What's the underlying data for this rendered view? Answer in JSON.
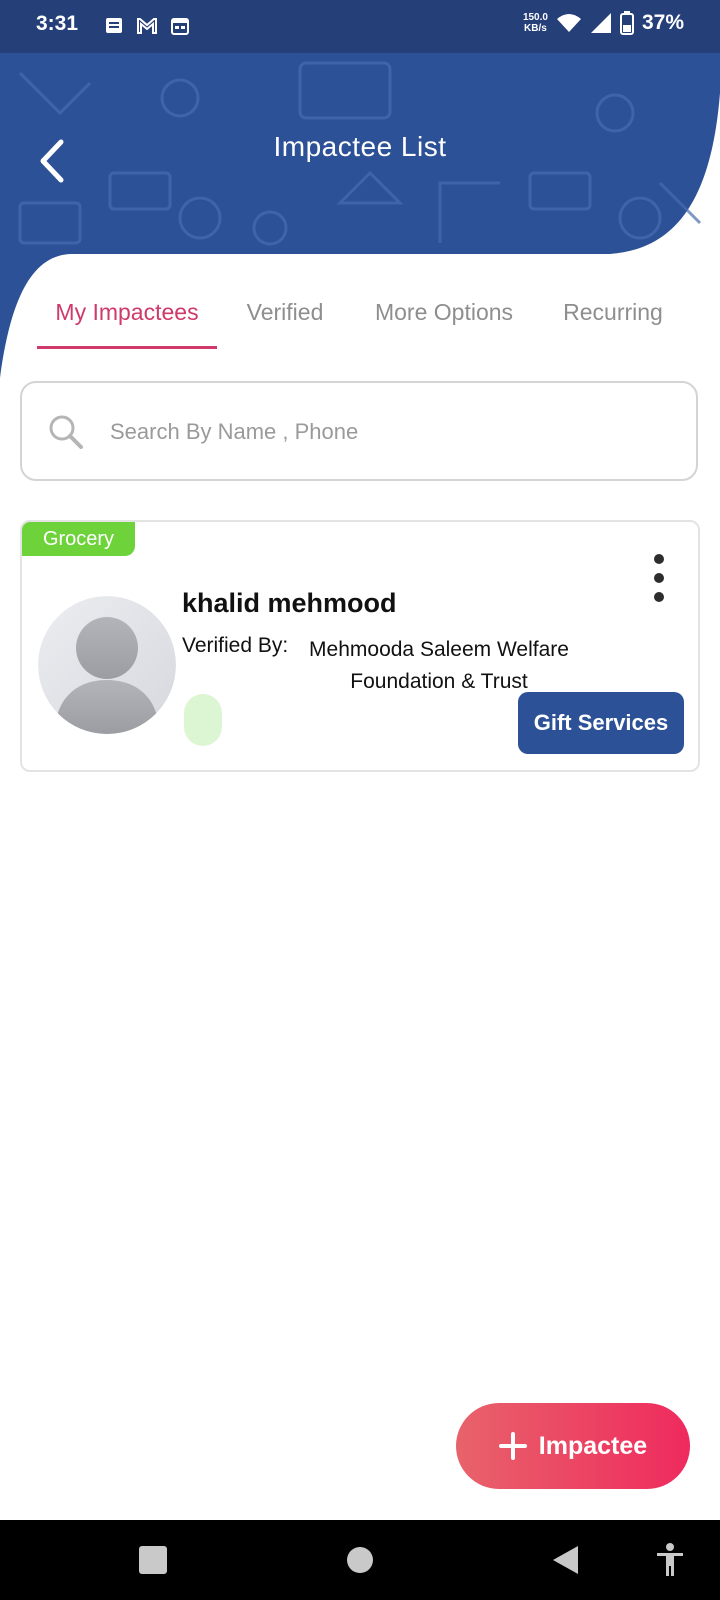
{
  "status_bar": {
    "time": "3:31",
    "net_speed_value": "150.0",
    "net_speed_unit": "KB/s",
    "battery": "37%",
    "icons_left": [
      "message-icon",
      "gmail-icon",
      "calendar-icon"
    ],
    "icons_right": [
      "wifi-icon",
      "signal-icon",
      "battery-icon"
    ]
  },
  "header": {
    "title": "Impactee List",
    "color": "#2c5197"
  },
  "tabs": [
    {
      "label": "My Impactees",
      "active": true
    },
    {
      "label": "Verified",
      "active": false
    },
    {
      "label": "More Options",
      "active": false
    },
    {
      "label": "Recurring",
      "active": false
    }
  ],
  "search": {
    "placeholder": "Search By Name , Phone",
    "value": ""
  },
  "impactees": [
    {
      "category": "Grocery",
      "name": "khalid mehmood",
      "verified_by_label": "Verified By:",
      "verified_by": "Mehmooda Saleem Welfare Foundation & Trust",
      "action_label": "Gift Services"
    }
  ],
  "fab": {
    "label": "Impactee",
    "icon": "plus-icon"
  },
  "colors": {
    "accent": "#cf3a6a",
    "primary": "#2c5197",
    "badge_green": "#6ed33b",
    "fab_start": "#e8636a",
    "fab_end": "#ef2a5e"
  }
}
